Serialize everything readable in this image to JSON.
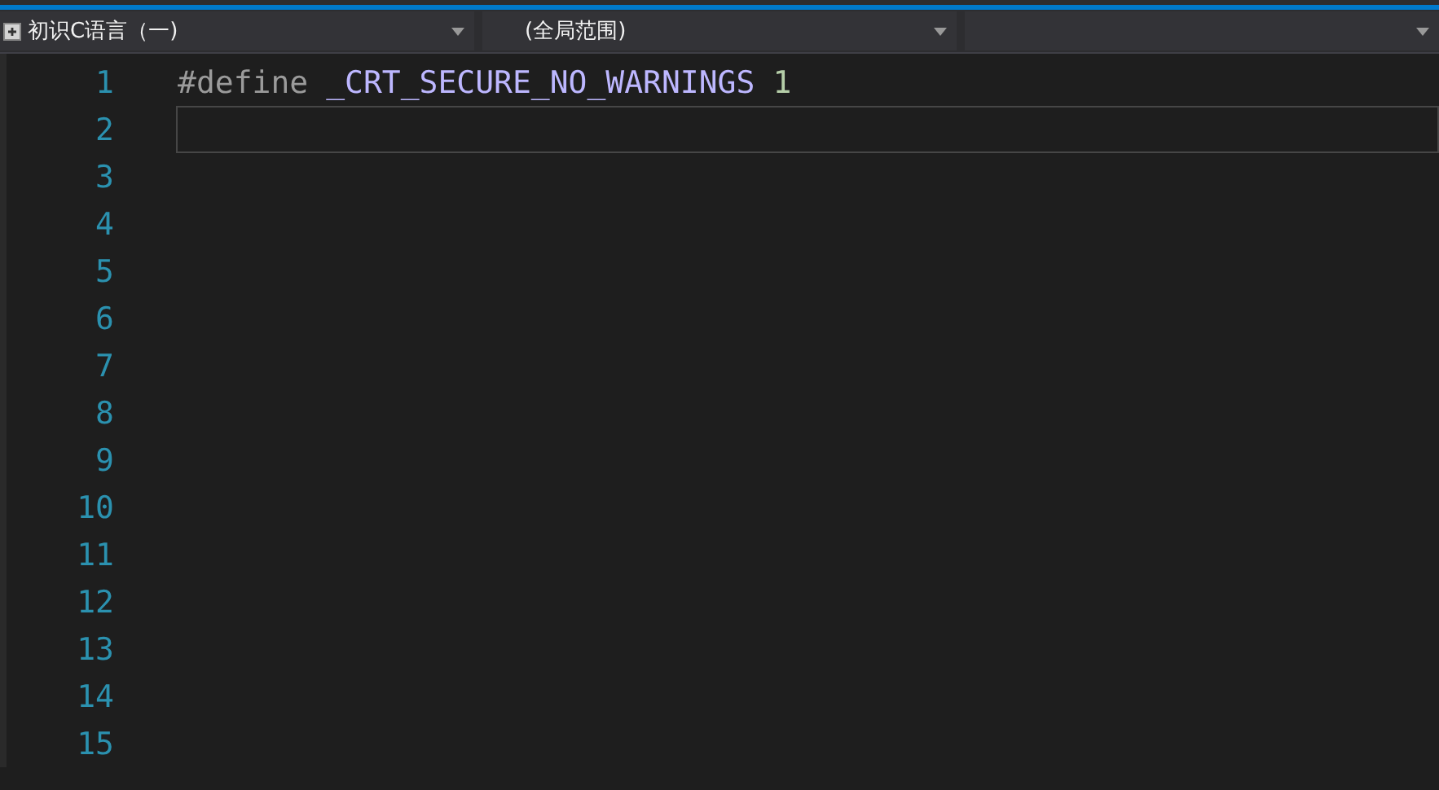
{
  "navigation_bar": [
    {
      "text": "初识C语言（一)",
      "kind": "project"
    },
    {
      "text": "(全局范围)",
      "kind": "scope"
    },
    {
      "kind": "member"
    }
  ],
  "editor": {
    "lines": [
      {
        "number": "1",
        "current": false,
        "tokens": [
          {
            "text": "#define",
            "kind": "preprocessor"
          },
          {
            "text": "_CRT_SECURE_NO_WARNINGS",
            "kind": "macro"
          },
          {
            "text": "1",
            "kind": "number"
          }
        ]
      },
      {
        "number": "2",
        "current": true
      },
      {
        "number": "3",
        "current": false
      },
      {
        "number": "4",
        "current": false
      },
      {
        "number": "5",
        "current": false
      },
      {
        "number": "6",
        "current": false
      },
      {
        "number": "7",
        "current": false
      },
      {
        "number": "8",
        "current": false
      },
      {
        "number": "9",
        "current": false
      },
      {
        "number": "10",
        "current": false
      },
      {
        "number": "11",
        "current": false
      },
      {
        "number": "12",
        "current": false
      },
      {
        "number": "13",
        "current": false
      },
      {
        "number": "14",
        "current": false
      },
      {
        "number": "15",
        "current": false
      }
    ]
  }
}
